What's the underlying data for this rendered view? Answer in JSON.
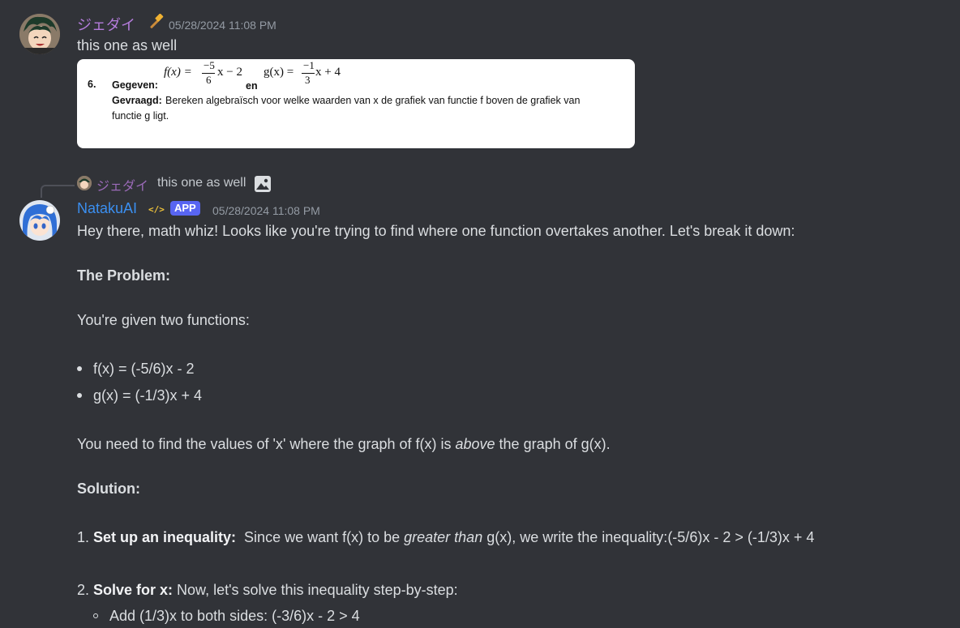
{
  "message1": {
    "username": "ジェダイ",
    "badge_icon": "hammer-icon",
    "timestamp": "05/28/2024 11:08 PM",
    "text": "this one as well",
    "attachment": {
      "number": "6.",
      "gegeven_label": "Gegeven:",
      "f_expr_prefix": "f(x) =",
      "f_num": "−5",
      "f_den": "6",
      "f_suffix": "x − 2",
      "en": "en",
      "g_expr_prefix": "g(x) =",
      "g_num": "−1",
      "g_den": "3",
      "g_suffix": "x + 4",
      "gevraagd_label": "Gevraagd:",
      "gevraagd_text_1": "Bereken algebraïsch voor welke waarden van x de grafiek van functie f boven de grafiek van",
      "gevraagd_text_2": "functie g ligt."
    }
  },
  "reply_preview": {
    "username": "ジェダイ",
    "text": "this one as well",
    "image_icon": "image-icon"
  },
  "message2": {
    "username": "NatakuAI",
    "dev_badge": "</>",
    "app_badge": "APP",
    "timestamp": "05/28/2024 11:08 PM",
    "intro": "Hey there, math whiz!  Looks like you're trying to find where one function overtakes another. Let's break it down:",
    "problem_heading": "The Problem:",
    "given": "You're given two functions:",
    "bullets": [
      "f(x) = (-5/6)x - 2",
      "g(x) = (-1/3)x + 4"
    ],
    "need_pre": "You need to find the values of 'x' where the graph of f(x) is ",
    "need_em": "above",
    "need_post": " the graph of g(x).",
    "solution_heading": "Solution:",
    "step1_num": "1. ",
    "step1_bold": "Set up an inequality:",
    "step1_pre": "  Since we want f(x) to be ",
    "step1_em": "greater than",
    "step1_post": " g(x), we write the inequality:(-5/6)x - 2 > (-1/3)x + 4",
    "step2_num": "2. ",
    "step2_bold": "Solve for x:",
    "step2_post": " Now, let's solve this inequality step-by-step:",
    "sub1": "Add (1/3)x to both sides: (-3/6)x - 2 > 4"
  },
  "colors": {
    "background": "#313338",
    "username1": "#b47cdb",
    "username2": "#3b8ff0",
    "app_badge": "#5865f2"
  }
}
